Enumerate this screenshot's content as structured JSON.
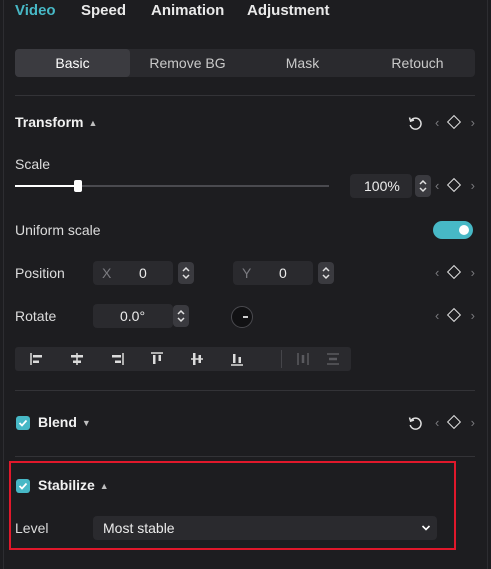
{
  "top_tabs": [
    {
      "label": "Video",
      "active": true
    },
    {
      "label": "Speed"
    },
    {
      "label": "Animation"
    },
    {
      "label": "Adjustment"
    }
  ],
  "sub_tabs": [
    {
      "label": "Basic",
      "active": true
    },
    {
      "label": "Remove BG"
    },
    {
      "label": "Mask"
    },
    {
      "label": "Retouch"
    }
  ],
  "transform": {
    "title": "Transform",
    "scale_label": "Scale",
    "scale_value": "100%",
    "scale_slider_fraction": 0.2,
    "uniform_scale_label": "Uniform scale",
    "uniform_scale_on": true,
    "position_label": "Position",
    "position_x_prefix": "X",
    "position_x": "0",
    "position_y_prefix": "Y",
    "position_y": "0",
    "rotate_label": "Rotate",
    "rotate_value": "0.0°",
    "align_icons": [
      "align-left-icon",
      "align-center-horizontal-icon",
      "align-right-icon",
      "align-top-icon",
      "align-center-vertical-icon",
      "align-bottom-icon",
      "distribute-horizontal-icon",
      "distribute-vertical-icon"
    ]
  },
  "blend": {
    "title": "Blend",
    "checked": true
  },
  "stabilize": {
    "title": "Stabilize",
    "checked": true,
    "level_label": "Level",
    "level_value": "Most stable"
  },
  "colors": {
    "accent": "#47b8c6",
    "background": "#1d1d20",
    "highlight": "#e0182b"
  }
}
